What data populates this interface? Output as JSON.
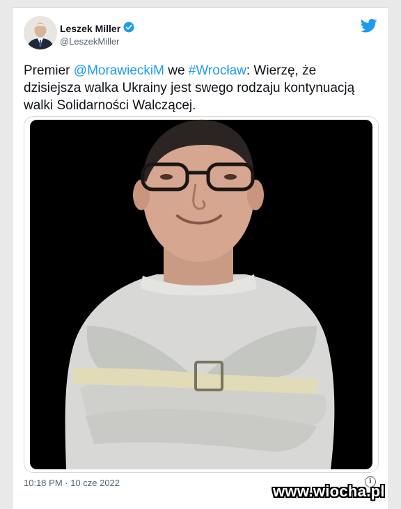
{
  "tweet": {
    "author_name": "Leszek Miller",
    "author_handle": "@LeszekMiller",
    "verified_color": "#1d9bf0",
    "text_prefix": "Premier ",
    "mention": "@MorawieckiM",
    "text_mid": " we ",
    "hashtag": "#Wrocław",
    "text_suffix": ": Wierzę, że dzisiejsza walka Ukrainy jest swego rodzaju kontynuacją walki Solidarności Walczącej.",
    "timestamp": "10:18 PM · 10 cze 2022",
    "info_glyph": "i"
  },
  "watermark": "www.wiocha.pl",
  "icons": {
    "brand": "twitter-bird-icon",
    "verified": "verified-badge-icon",
    "info": "info-icon"
  },
  "colors": {
    "link": "#1d9bf0",
    "text": "#0f1419",
    "muted": "#536471"
  }
}
